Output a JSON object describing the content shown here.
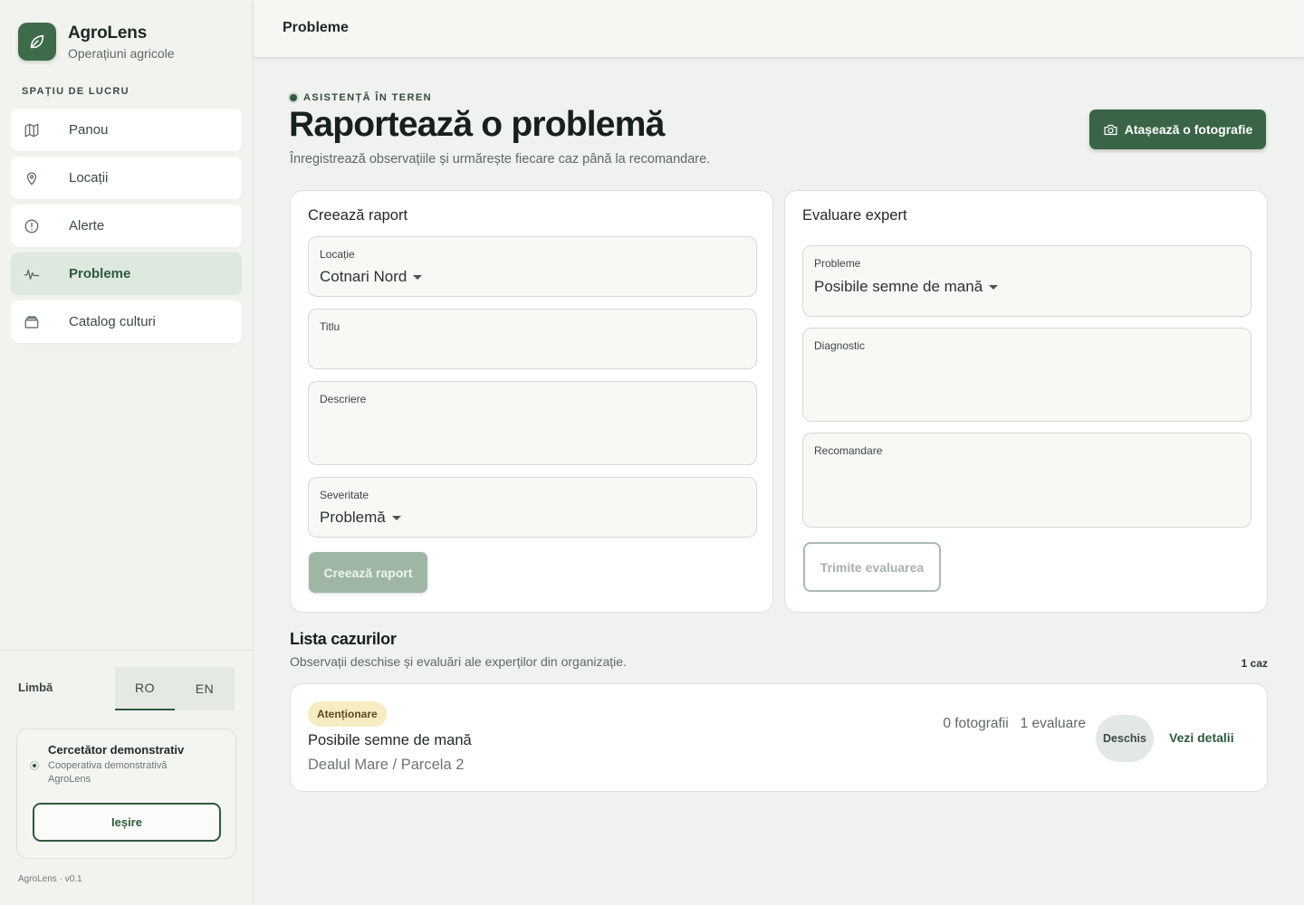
{
  "app": {
    "name": "AgroLens",
    "subtitle": "Operațiuni agricole",
    "version": "AgroLens · v0.1",
    "accent": "#3a6446"
  },
  "sidebar": {
    "section_label": "SPAȚIU DE LUCRU",
    "items": [
      {
        "label": "Panou",
        "icon": "map-icon",
        "active": false
      },
      {
        "label": "Locații",
        "icon": "location-pin-icon",
        "active": false
      },
      {
        "label": "Alerte",
        "icon": "alert-circle-icon",
        "active": false
      },
      {
        "label": "Probleme",
        "icon": "activity-icon",
        "active": true
      },
      {
        "label": "Catalog culturi",
        "icon": "archive-icon",
        "active": false
      }
    ],
    "language": {
      "label": "Limbă",
      "options": [
        "RO",
        "EN"
      ],
      "selected": "RO"
    },
    "user": {
      "name": "Cercetător demonstrativ",
      "org": "Cooperativa demonstrativă AgroLens",
      "logout_label": "Ieșire"
    }
  },
  "topbar": {
    "title": "Probleme"
  },
  "header": {
    "eyebrow": "ASISTENȚĂ ÎN TEREN",
    "title": "Raportează o problemă",
    "subtitle": "Înregistrează observațiile și urmărește fiecare caz până la recomandare.",
    "attach_label": "Atașează o fotografie"
  },
  "create_report": {
    "title": "Creează raport",
    "location": {
      "label": "Locație",
      "value": "Cotnari Nord"
    },
    "title_field": {
      "label": "Titlu",
      "value": ""
    },
    "description": {
      "label": "Descriere",
      "value": ""
    },
    "severity": {
      "label": "Severitate",
      "value": "Problemă"
    },
    "submit_label": "Creează raport"
  },
  "expert_review": {
    "title": "Evaluare expert",
    "problems": {
      "label": "Probleme",
      "value": "Posibile semne de mană"
    },
    "diagnosis": {
      "label": "Diagnostic",
      "value": ""
    },
    "recommendation": {
      "label": "Recomandare",
      "value": ""
    },
    "submit_label": "Trimite evaluarea"
  },
  "cases": {
    "title": "Lista cazurilor",
    "subtitle": "Observații deschise și evaluări ale experților din organizație.",
    "count_label": "1 caz",
    "items": [
      {
        "badge": "Atenționare",
        "title": "Posibile semne de mană",
        "location": "Dealul Mare / Parcela 2",
        "meta": "0 fotografii   1 evaluare",
        "status": "Deschis",
        "link_label": "Vezi detalii"
      }
    ]
  }
}
